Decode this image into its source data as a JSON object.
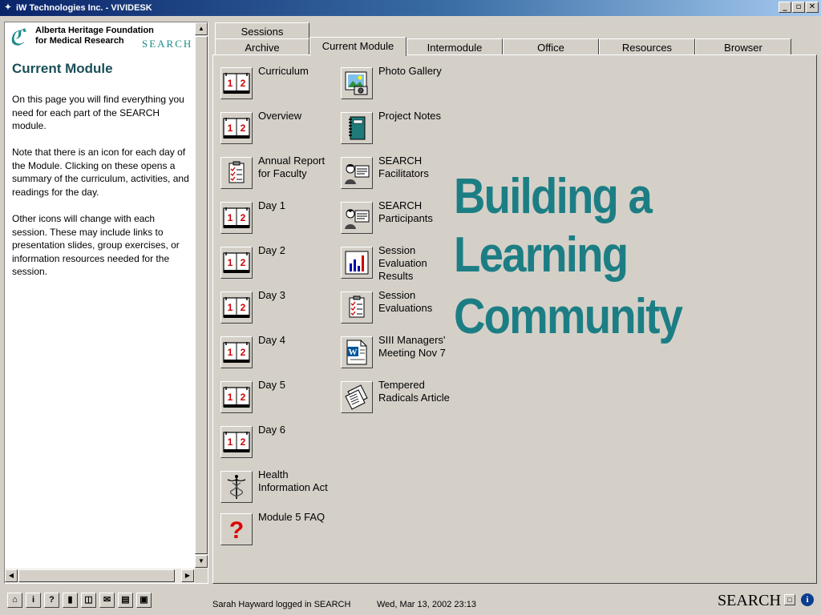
{
  "window": {
    "title": "iW Technologies Inc. - VIVIDESK",
    "minimize": "_",
    "restore": "▫",
    "close": "✕"
  },
  "sidebar": {
    "org_line1": "Alberta Heritage Foundation",
    "org_line2": "for Medical Research",
    "org_search": "SEARCH",
    "title": "Current Module",
    "paragraphs": [
      "On this page you will find everything you need for each part of the SEARCH module.",
      "Note that there is an icon for each day of the Module. Clicking on these opens a summary of the curriculum, activities, and readings for the day.",
      "Other icons will change with each session. These may include links to presentation slides, group exercises, or information resources needed for the session."
    ]
  },
  "tabs": {
    "row1": [
      "Sessions"
    ],
    "row2": [
      "Archive",
      "Current Module",
      "Intermodule",
      "Office",
      "Resources",
      "Browser"
    ],
    "active": "Current Module"
  },
  "items_col1": [
    {
      "label": "Curriculum",
      "icon": "calendar-book-icon"
    },
    {
      "label": "Overview",
      "icon": "calendar-book-icon"
    },
    {
      "label": "Annual Report\nfor Faculty",
      "icon": "checklist-icon"
    },
    {
      "label": "Day 1",
      "icon": "calendar-book-icon"
    },
    {
      "label": "Day 2",
      "icon": "calendar-book-icon"
    },
    {
      "label": "Day 3",
      "icon": "calendar-book-icon"
    },
    {
      "label": "Day 4",
      "icon": "calendar-book-icon"
    },
    {
      "label": "Day 5",
      "icon": "calendar-book-icon"
    },
    {
      "label": "Day 6",
      "icon": "calendar-book-icon"
    },
    {
      "label": "Health\nInformation Act",
      "icon": "caduceus-icon"
    },
    {
      "label": "Module 5 FAQ",
      "icon": "question-icon"
    }
  ],
  "items_col2": [
    {
      "label": "Photo Gallery",
      "icon": "photo-gallery-icon"
    },
    {
      "label": "Project Notes",
      "icon": "notebook-icon"
    },
    {
      "label": "SEARCH\nFacilitators",
      "icon": "facilitator-icon"
    },
    {
      "label": "SEARCH\nParticipants",
      "icon": "participant-icon"
    },
    {
      "label": "Session\nEvaluation\nResults",
      "icon": "bar-chart-icon"
    },
    {
      "label": "Session\nEvaluations",
      "icon": "checklist-icon"
    },
    {
      "label": "SIII Managers'\nMeeting Nov 7",
      "icon": "word-document-icon"
    },
    {
      "label": "Tempered\nRadicals Article",
      "icon": "newspaper-icon"
    }
  ],
  "banner": [
    "Building a",
    "Learning",
    "Community"
  ],
  "status": {
    "user": "Sarah Hayward logged in SEARCH",
    "datetime": "Wed, Mar 13, 2002 23:13",
    "brand": "SEARCH",
    "icons": [
      "home-icon",
      "info-icon",
      "help-icon",
      "lock-icon",
      "chat-icon",
      "mail-icon",
      "note-icon",
      "folder-icon"
    ]
  },
  "colors": {
    "accent": "#1c7e84",
    "title_bar": "#0a246a",
    "face": "#d4d0c8"
  }
}
